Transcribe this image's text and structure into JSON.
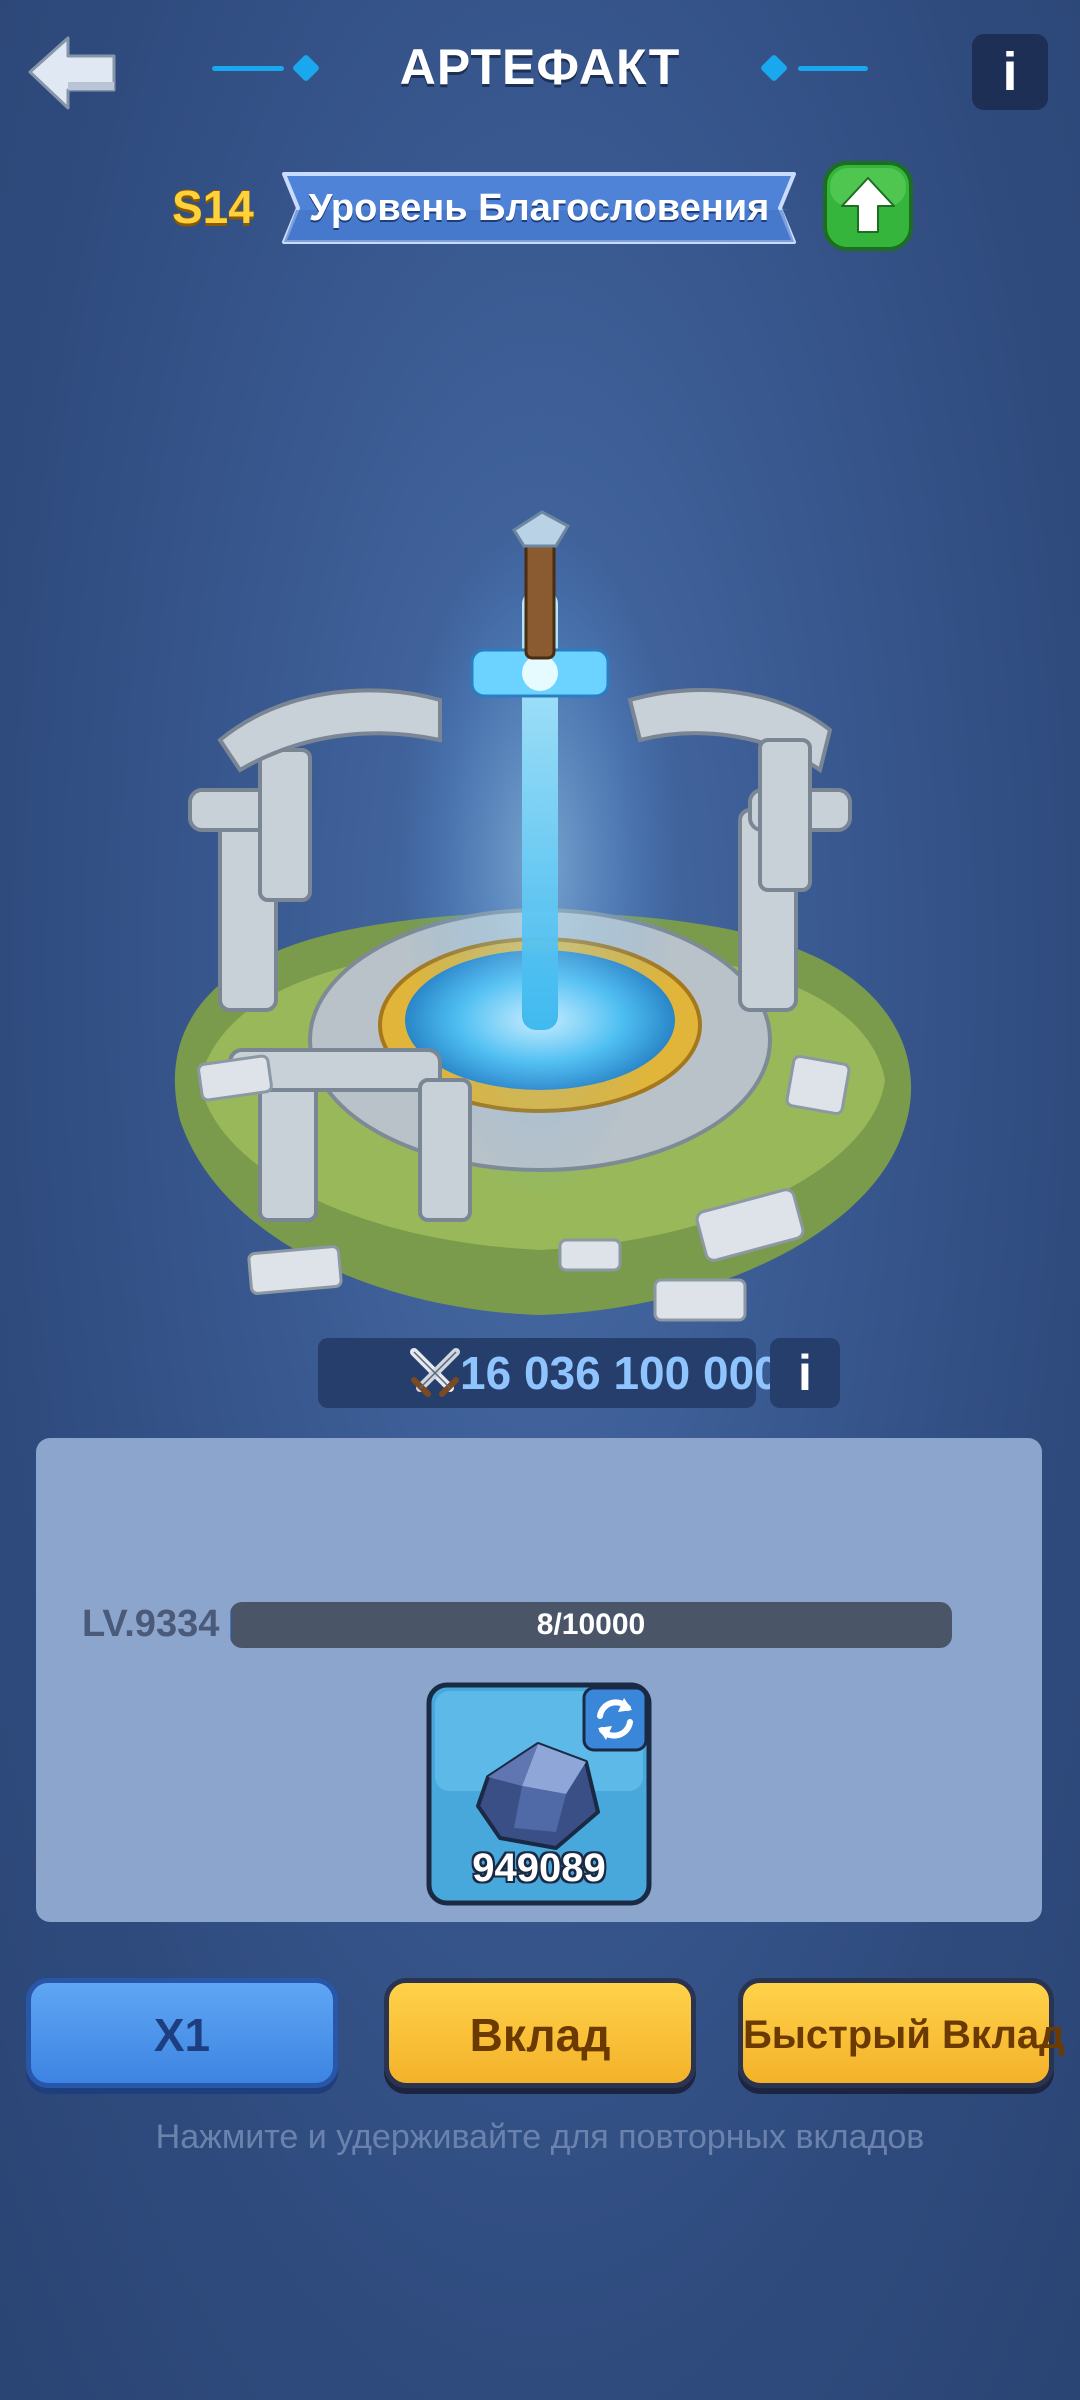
{
  "header": {
    "title": "АРТЕФАКТ",
    "back_icon": "back-arrow-icon",
    "info_label": "i"
  },
  "season": {
    "label": "S14",
    "banner_label": "Уровень Благословения",
    "upgrade_icon": "up-arrow-icon"
  },
  "artifact": {
    "power_icon": "crossed-swords-icon",
    "power_value": "16 036 100 000",
    "info_label": "i"
  },
  "level": {
    "label": "LV.9334",
    "progress_text": "8/10000",
    "progress_fraction": 0.0008
  },
  "item": {
    "icon": "stone-icon",
    "refresh_icon": "refresh-icon",
    "count": "949089"
  },
  "buttons": {
    "multiplier": "X1",
    "deposit": "Вклад",
    "quick_deposit": "Быстрый Вклад"
  },
  "hint": "Нажмите и удерживайте для повторных вкладов",
  "colors": {
    "accent_blue": "#19a8ee",
    "gold": "#ffd23b",
    "button_blue": "#4b93ea",
    "button_yellow": "#f8c23a",
    "panel": "#8ba5cd"
  }
}
